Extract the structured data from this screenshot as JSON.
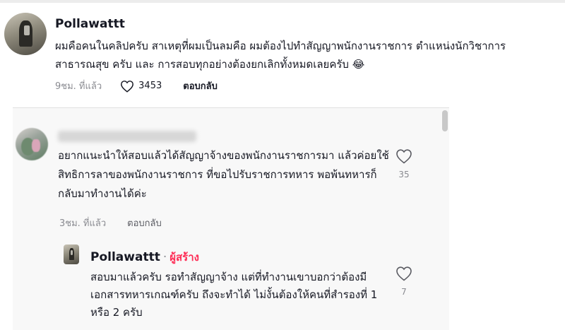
{
  "post": {
    "username": "Pollawattt",
    "text": "ผมคือคนในคลิปครับ สาเหตุที่ผมเป็นลมคือ ผมต้องไปทำสัญญาพนักงานราชการ ตำแหน่งนักวิชาการสาธารณสุข ครับ และ การสอบทุกอย่างต้องยกเลิกทั้งหมดเลยครับ 😂",
    "time": "9ชม. ที่แล้ว",
    "likes": "3453",
    "reply_label": "ตอบกลับ"
  },
  "comment": {
    "text": "อยากแนะนำให้สอบแล้วได้สัญญาจ้างของพนักงานราชการมา แล้วค่อยใช้สิทธิการลาของพนักงานราชการ ที่ขอไปรับราชการทหาร พอพ้นทหารก็กลับมาทำงานได้ค่ะ",
    "time": "3ชม. ที่แล้ว",
    "reply_label": "ตอบกลับ",
    "likes": "35"
  },
  "reply": {
    "username": "Pollawattt",
    "separator": "·",
    "creator_badge": "ผู้สร้าง",
    "text": "สอบมาแล้วครับ รอทำสัญญาจ้าง แต่ที่ทำงานเขาบอกว่าต้องมีเอกสารทหารเกณฑ์ครับ ถึงจะทำได้ ไม่งั้นต้องให้คนที่สำรองที่ 1 หรือ 2 ครับ",
    "likes": "7"
  },
  "colors": {
    "creator": "#fe2c55",
    "muted": "#8a8b91",
    "text": "#161823"
  },
  "icons": {
    "like": "heart-outline-icon"
  }
}
